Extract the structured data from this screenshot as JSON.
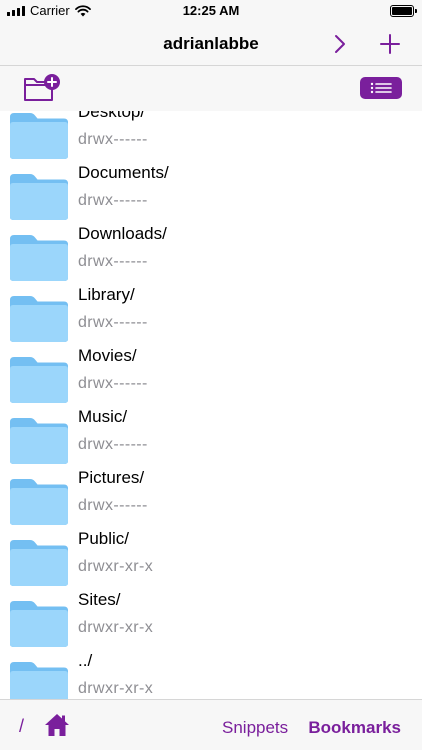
{
  "status_bar": {
    "carrier": "Carrier",
    "time": "12:25 AM"
  },
  "nav": {
    "title": "adrianlabbe",
    "forward_icon": "chevron-right-icon",
    "add_icon": "plus-icon"
  },
  "toolbar": {
    "new_folder_icon": "folder-plus-icon",
    "list_icon": "list-icon"
  },
  "files": [
    {
      "name": "Desktop/",
      "permissions": "drwx------"
    },
    {
      "name": "Documents/",
      "permissions": "drwx------"
    },
    {
      "name": "Downloads/",
      "permissions": "drwx------"
    },
    {
      "name": "Library/",
      "permissions": "drwx------"
    },
    {
      "name": "Movies/",
      "permissions": "drwx------"
    },
    {
      "name": "Music/",
      "permissions": "drwx------"
    },
    {
      "name": "Pictures/",
      "permissions": "drwx------"
    },
    {
      "name": "Public/",
      "permissions": "drwxr-xr-x"
    },
    {
      "name": "Sites/",
      "permissions": "drwxr-xr-x"
    },
    {
      "name": "../",
      "permissions": "drwxr-xr-x"
    }
  ],
  "bottom_bar": {
    "root_label": "/",
    "home_icon": "home-icon",
    "snippets_label": "Snippets",
    "bookmarks_label": "Bookmarks"
  },
  "colors": {
    "accent": "#7a1f9c",
    "folder": "#8fd0fa",
    "secondary_text": "#8e8e93"
  }
}
